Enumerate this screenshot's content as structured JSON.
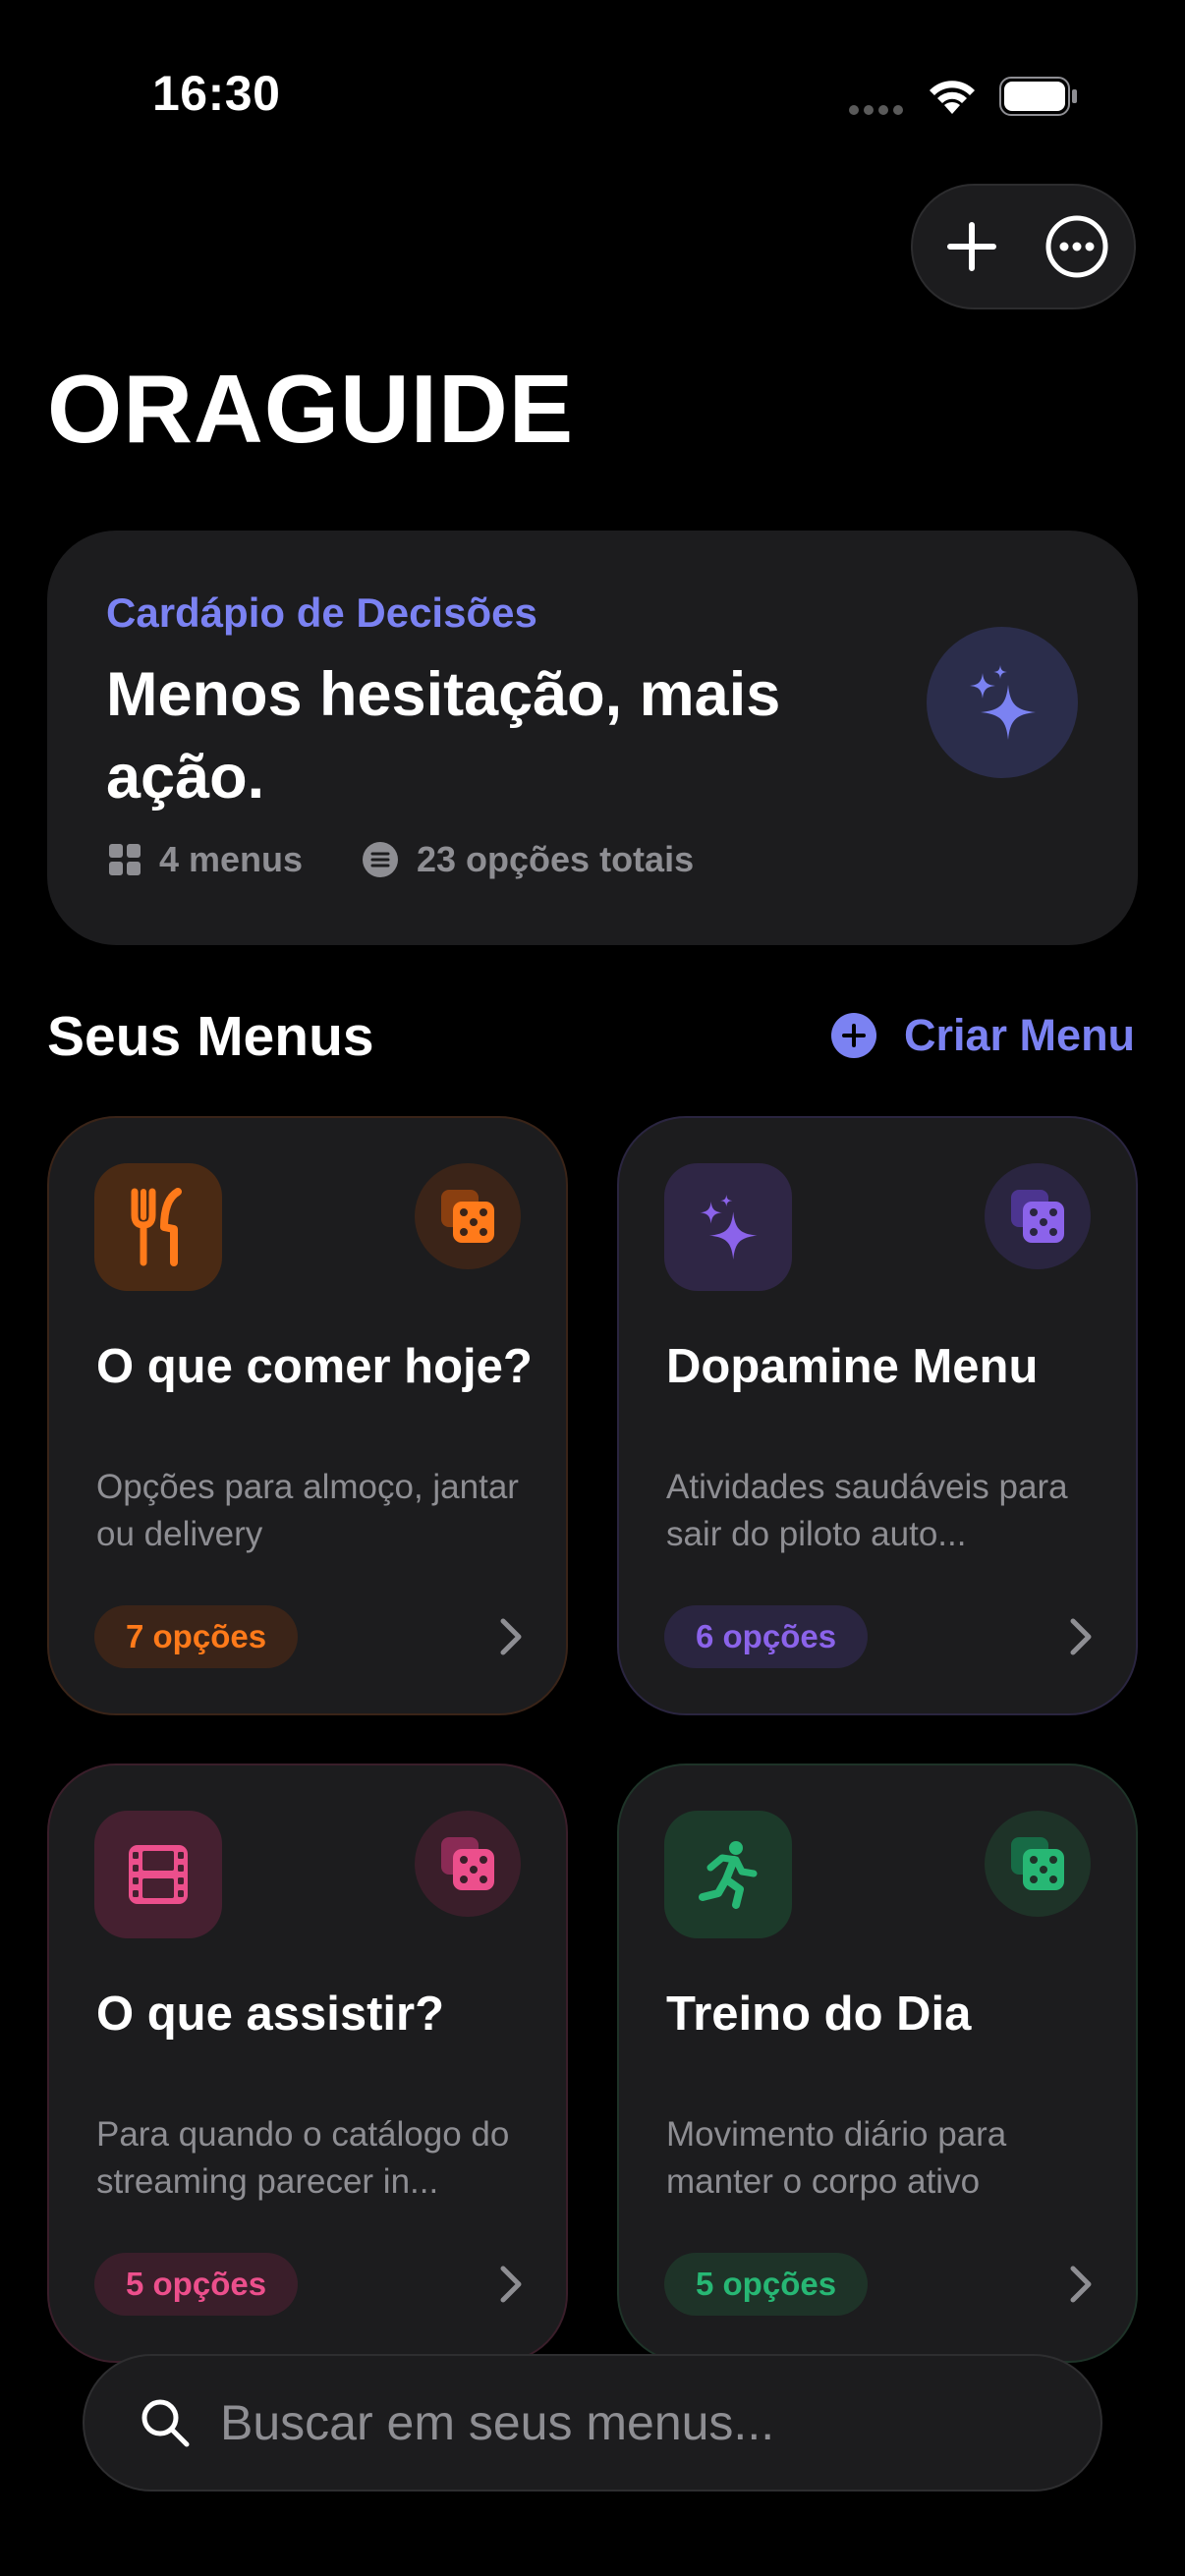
{
  "status_bar": {
    "time": "16:30"
  },
  "header": {
    "title": "ORAGUIDE",
    "actions": [
      "plus-icon",
      "more-icon"
    ]
  },
  "hero": {
    "kicker": "Cardápio de Decisões",
    "headline": "Menos hesitação, mais ação.",
    "menus_count": "4 menus",
    "options_total": "23 opções totais",
    "icon": "sparkles-icon"
  },
  "section": {
    "title": "Seus Menus",
    "create_label": "Criar Menu"
  },
  "menus": [
    {
      "title": "O que comer hoje?",
      "description": "Opções para almoço, jantar ou delivery",
      "badge": "7 opções",
      "icon": "fork-knife-icon",
      "color": "#ff7a1a"
    },
    {
      "title": "Dopamine Menu",
      "description": "Atividades saudáveis para sair do piloto auto...",
      "badge": "6 opções",
      "icon": "sparkles-icon",
      "color": "#8b63ea"
    },
    {
      "title": "O que assistir?",
      "description": "Para quando o catálogo do streaming parecer in...",
      "badge": "5 opções",
      "icon": "film-icon",
      "color": "#ec4f8c"
    },
    {
      "title": "Treino do Dia",
      "description": "Movimento diário para manter o corpo ativo",
      "badge": "5 opções",
      "icon": "running-figure-icon",
      "color": "#27b774"
    }
  ],
  "search": {
    "placeholder": "Buscar em seus menus..."
  }
}
